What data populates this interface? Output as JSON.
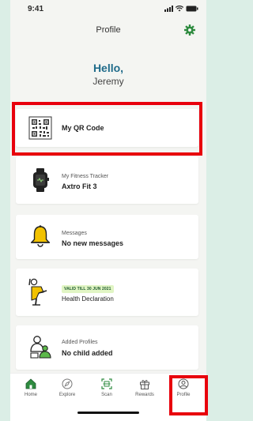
{
  "status": {
    "time": "9:41"
  },
  "header": {
    "title": "Profile"
  },
  "greeting": {
    "hello": "Hello,",
    "name": "Jeremy"
  },
  "cards": {
    "qr": {
      "main": "My QR Code"
    },
    "fitness": {
      "sub": "My Fitness Tracker",
      "main": "Axtro Fit 3"
    },
    "messages": {
      "sub": "Messages",
      "main": "No new messages"
    },
    "health": {
      "badge": "VALID TILL 30 JUN 2021",
      "main": "Health Declaration"
    },
    "profiles": {
      "sub": "Added Profiles",
      "main": "No child added"
    }
  },
  "tabs": {
    "home": "Home",
    "explore": "Explore",
    "scan": "Scan",
    "rewards": "Rewards",
    "profile": "Profile"
  },
  "colors": {
    "accent": "#1f6b8a",
    "green": "#2e8b3f",
    "highlight": "#e8000c"
  }
}
